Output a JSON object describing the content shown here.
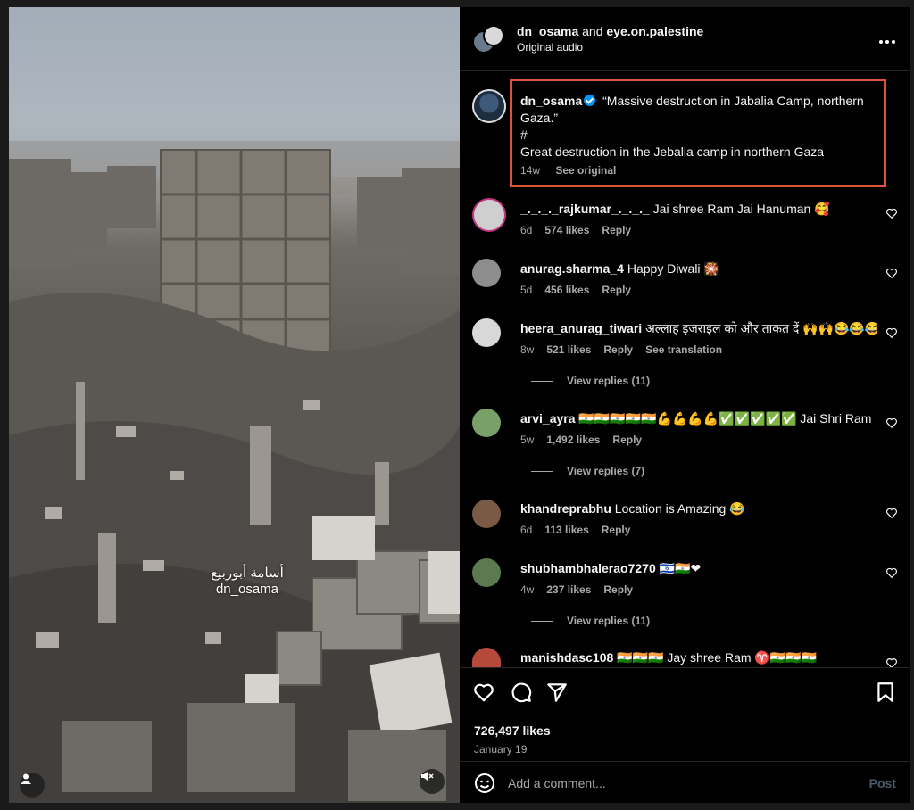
{
  "header": {
    "user1": "dn_osama",
    "joiner": "and",
    "user2": "eye.on.palestine",
    "audio": "Original audio",
    "more_icon": "more-horizontal-icon"
  },
  "media": {
    "watermark_line1": "أسامة أبوربيع",
    "watermark_line2": "dn_osama"
  },
  "caption": {
    "username": "dn_osama",
    "text_line1": "“Massive destruction in Jabalia Camp, northern",
    "text_line2": "Gaza.”",
    "text_line3": "#",
    "text_line4": "Great destruction in the Jebalia camp in northern Gaza",
    "time": "14w",
    "see_original": "See original",
    "highlight_color": "#e0533a"
  },
  "comments": [
    {
      "username": "_._._._rajkumar_._._._",
      "text": "Jai shree Ram Jai Hanuman 🥰",
      "time": "6d",
      "likes": "574 likes",
      "reply": "Reply"
    },
    {
      "username": "anurag.sharma_4",
      "text": "Happy Diwali 🎇",
      "time": "5d",
      "likes": "456 likes",
      "reply": "Reply"
    },
    {
      "username": "heera_anurag_tiwari",
      "text": "अल्लाह इजराइल को और ताकत दें 🙌🙌😂😂😂",
      "time": "8w",
      "likes": "521 likes",
      "reply": "Reply",
      "translation": "See translation",
      "view_replies": "View replies (11)"
    },
    {
      "username": "arvi_ayra",
      "text": "🇮🇳🇮🇳🇮🇳🇮🇳🇮🇳💪💪💪💪✅✅✅✅✅ Jai Shri Ram",
      "time": "5w",
      "likes": "1,492 likes",
      "reply": "Reply",
      "view_replies": "View replies (7)"
    },
    {
      "username": "khandreprabhu",
      "text": "Location is Amazing 😂",
      "time": "6d",
      "likes": "113 likes",
      "reply": "Reply"
    },
    {
      "username": "shubhambhalerao7270",
      "text": "🇮🇱🇮🇳❤",
      "time": "4w",
      "likes": "237 likes",
      "reply": "Reply",
      "view_replies": "View replies (11)"
    },
    {
      "username": "manishdasc108",
      "text": "🇮🇳🇮🇳🇮🇳 Jay shree Ram ♈🇮🇳🇮🇳🇮🇳",
      "time": "",
      "likes": "",
      "reply": ""
    }
  ],
  "actions": {
    "like_icon": "heart-icon",
    "comment_icon": "comment-icon",
    "share_icon": "share-icon",
    "save_icon": "bookmark-icon",
    "likes": "726,497 likes",
    "date": "January 19"
  },
  "add_comment": {
    "placeholder": "Add a comment...",
    "post_label": "Post"
  }
}
